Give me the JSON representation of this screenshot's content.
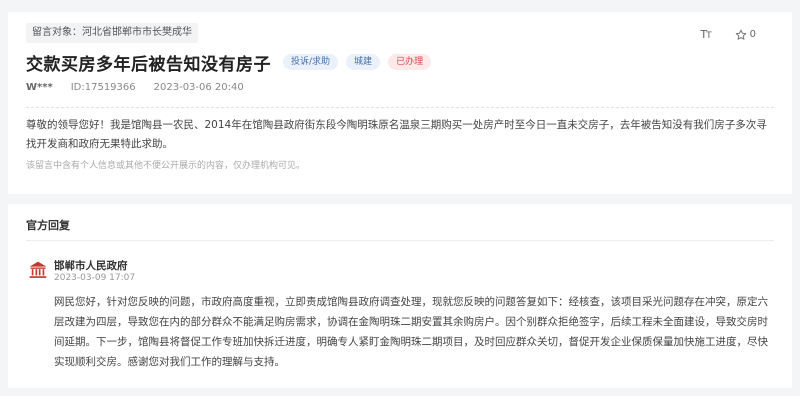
{
  "message": {
    "recipient_tag": "留言对象：河北省邯郸市市长樊成华",
    "title": "交款买房多年后被告知没有房子",
    "badges": {
      "type": "投诉/求助",
      "domain": "城建",
      "status": "已办理"
    },
    "user": "W***",
    "id_label": "ID:17519366",
    "datetime": "2023-03-06 20:40",
    "body": "尊敬的领导您好！我是馆陶县一农民、2014年在馆陶县政府街东段今陶明珠原名温泉三期购买一处房产时至今日一直未交房子，去年被告知没有我们房子多次寻找开发商和政府无果特此求助。",
    "disclaimer": "该留言中含有个人信息或其他不便公开展示的内容，仅办理机构可见。"
  },
  "toolbar": {
    "font_size_icon": "font-size-icon",
    "star_count": "0",
    "star_icon": "star-outline-icon"
  },
  "reply": {
    "heading": "官方回复",
    "org_name": "邯郸市人民政府",
    "org_icon": "government-building-icon",
    "time": "2023-03-09 17:07",
    "text": "网民您好，针对您反映的问题，市政府高度重视，立即责成馆陶县政府调查处理，现就您反映的问题答复如下：经核查，该项目采光问题存在冲突，原定六层改建为四层，导致您在内的部分群众不能满足购房需求，协调在金陶明珠二期安置其余购房户。因个别群众拒绝签字，后续工程未全面建设，导致交房时间延期。下一步，馆陶县将督促工作专班加快拆迁进度，明确专人紧盯金陶明珠二期项目，及时回应群众关切，督促开发企业保质保量加快施工进度，尽快实现顺利交房。感谢您对我们工作的理解与支持。"
  },
  "colors": {
    "background": "#f4f5f7",
    "status_red": "#d9494f",
    "tag_blue": "#4b6fa8",
    "org_icon_red": "#c0392b"
  }
}
